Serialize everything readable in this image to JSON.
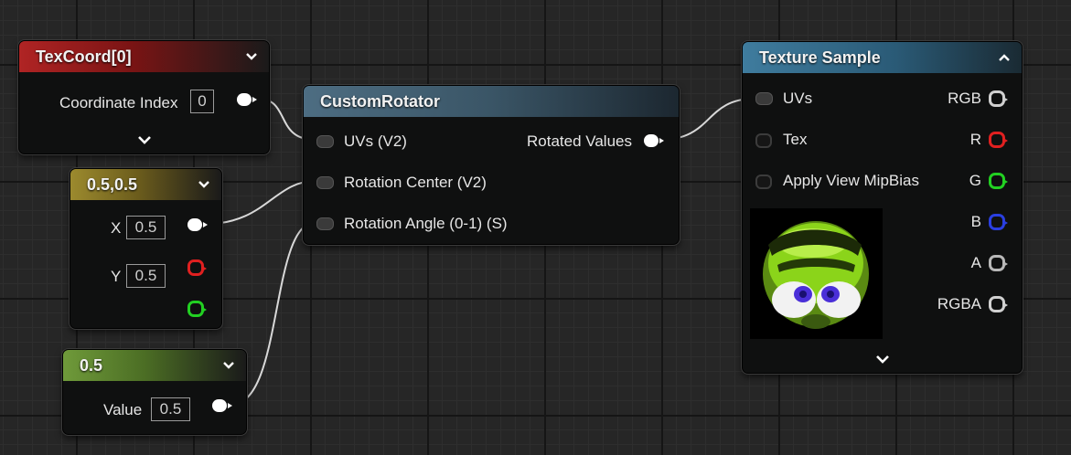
{
  "nodes": {
    "texcoord": {
      "title": "TexCoord[0]",
      "index_label": "Coordinate Index",
      "index_value": "0"
    },
    "vector2": {
      "title": "0.5,0.5",
      "x_label": "X",
      "x_value": "0.5",
      "y_label": "Y",
      "y_value": "0.5"
    },
    "scalar": {
      "title": "0.5",
      "value_label": "Value",
      "value": "0.5"
    },
    "rotator": {
      "title": "CustomRotator",
      "inputs": [
        "UVs (V2)",
        "Rotation Center (V2)",
        "Rotation Angle (0-1) (S)"
      ],
      "output": "Rotated Values"
    },
    "texture": {
      "title": "Texture Sample",
      "inputs": [
        "UVs",
        "Tex",
        "Apply View MipBias"
      ],
      "outputs": [
        "RGB",
        "R",
        "G",
        "B",
        "A",
        "RGBA"
      ]
    }
  },
  "colors": {
    "pin_red": "#e02020",
    "pin_green": "#22d022",
    "pin_blue": "#2a3fe0",
    "pin_gray": "#d0d0d0",
    "wire": "#d8d8d8"
  },
  "icons": [
    "chevron-down-icon",
    "chevron-up-icon",
    "texture-thumbnail"
  ]
}
